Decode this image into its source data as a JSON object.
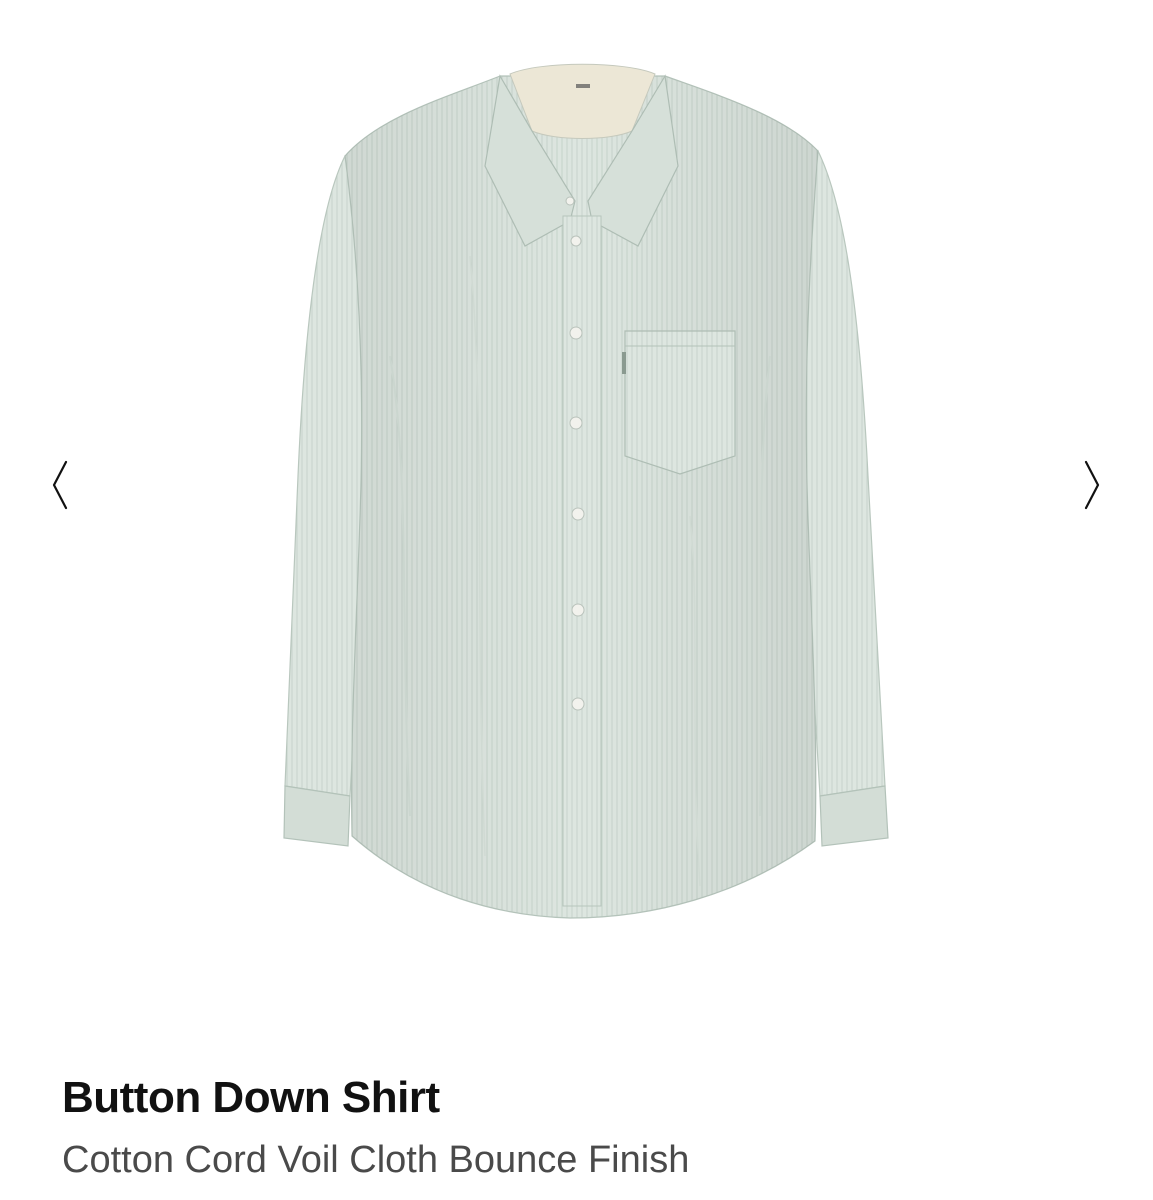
{
  "gallery": {
    "image_subject": "shirt",
    "shirt_color": "#d9e3dc",
    "prev_icon": "chevron-left-icon",
    "next_icon": "chevron-right-icon"
  },
  "product": {
    "title": "Button Down Shirt",
    "subtitle": "Cotton Cord Voil Cloth Bounce Finish"
  }
}
